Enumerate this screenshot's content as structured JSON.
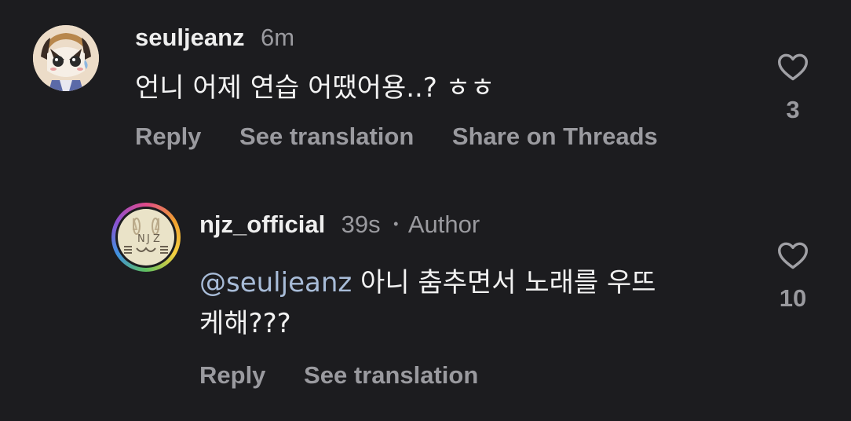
{
  "comments": [
    {
      "username": "seuljeanz",
      "time": "6m",
      "text": "언니 어제 연습 어땠어용..? ㅎㅎ",
      "actions": {
        "reply": "Reply",
        "translate": "See translation",
        "share": "Share on Threads"
      },
      "likes": "3",
      "like_icon": "heart-outline-icon"
    },
    {
      "username": "njz_official",
      "time": "39s",
      "separator": "•",
      "badge": "Author",
      "mention": "@seuljeanz",
      "text_line1": " 아니 춤추면서 노래를 우뜨",
      "text_line2": "케해???",
      "actions": {
        "reply": "Reply",
        "translate": "See translation"
      },
      "likes": "10",
      "like_icon": "heart-outline-icon"
    }
  ],
  "colors": {
    "background": "#1c1c1f",
    "text": "#f2f2f2",
    "muted": "#9a9a9f",
    "mention": "#a8bcd8"
  }
}
